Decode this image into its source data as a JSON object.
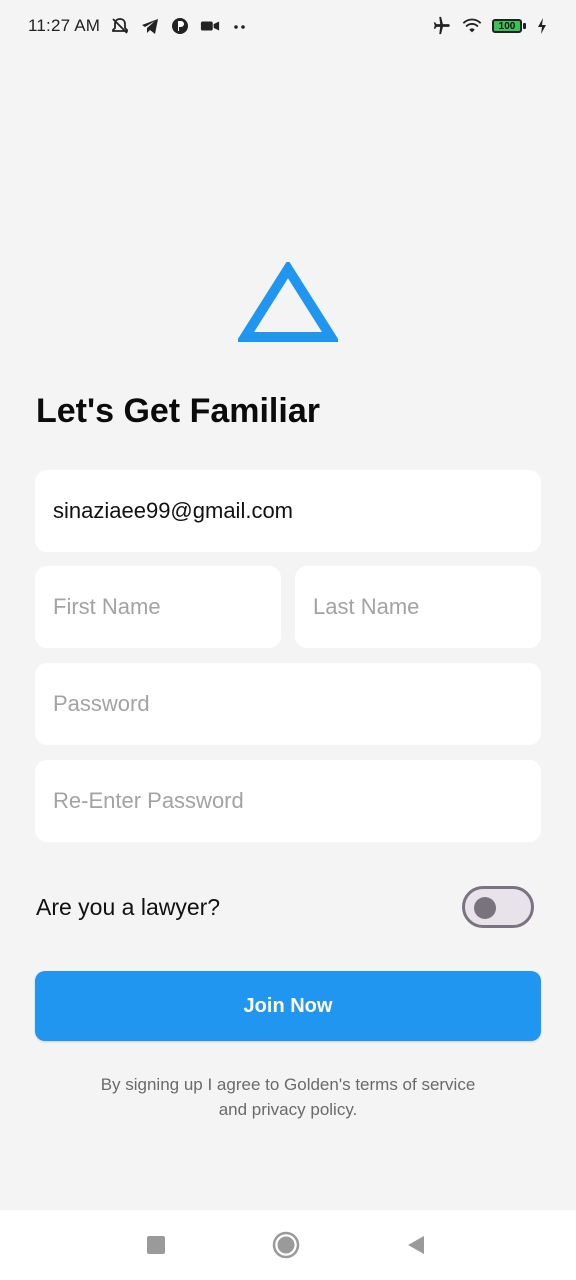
{
  "status_bar": {
    "time": "11:27 AM",
    "battery_level": "100",
    "icons": [
      "mute-vibrate-icon",
      "telegram-icon",
      "app-icon",
      "video-camera-icon",
      "more-dots-icon",
      "airplane-icon",
      "wifi-icon",
      "battery-icon",
      "charging-icon"
    ]
  },
  "logo": {
    "icon": "triangle-logo-icon",
    "color": "#2196f0"
  },
  "title": "Let's Get Familiar",
  "form": {
    "email_value": "sinaziaee99@gmail.com",
    "first_name_placeholder": "First Name",
    "last_name_placeholder": "Last Name",
    "password_placeholder": "Password",
    "reenter_password_placeholder": "Re-Enter Password"
  },
  "lawyer_toggle": {
    "label": "Are you a lawyer?",
    "checked": false
  },
  "join_button": {
    "label": "Join Now",
    "color": "#2196f0"
  },
  "terms": {
    "line1": "By signing up I agree to Golden's terms of service",
    "line2": "and privacy policy."
  },
  "nav_bar": {
    "icons": [
      "recents-icon",
      "home-icon",
      "back-icon"
    ]
  }
}
